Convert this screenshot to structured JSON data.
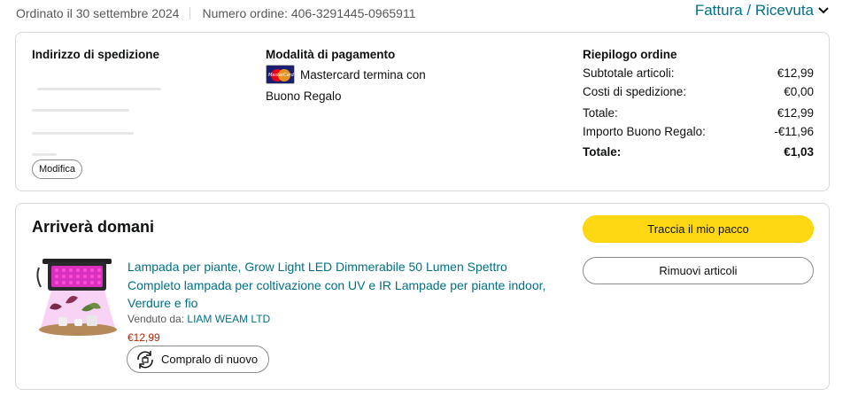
{
  "header": {
    "order_date": "Ordinato il 30 settembre 2024",
    "order_number": "Numero ordine: 406-3291445-0965911",
    "invoice_link": "Fattura / Ricevuta"
  },
  "shipping": {
    "title": "Indirizzo di spedizione",
    "edit_button": "Modifica"
  },
  "payment": {
    "title": "Modalità di pagamento",
    "card_text": "Mastercard termina con",
    "card_logo_text": "MasterCard",
    "gift_card": "Buono Regalo"
  },
  "summary": {
    "title": "Riepilogo ordine",
    "rows": [
      {
        "label": "Subtotale articoli:",
        "value": "€12,99"
      },
      {
        "label": "Costi di spedizione:",
        "value": "€0,00"
      },
      {
        "label": "Totale:",
        "value": "€12,99"
      },
      {
        "label": "Importo Buono Regalo:",
        "value": "-€11,96"
      }
    ],
    "grand_total_label": "Totale:",
    "grand_total_value": "€1,03"
  },
  "delivery": {
    "title": "Arriverà domani",
    "track_button": "Traccia il mio pacco",
    "remove_button": "Rimuovi articoli",
    "item": {
      "title": "Lampada per piante, Grow Light LED Dimmerabile 50 Lumen Spettro Completo lampada per coltivazione con UV e IR Lampade per piante indoor, Verdure e fio",
      "seller_label": "Venduto da:",
      "seller_name": "LIAM WEAM LTD",
      "price": "€12,99",
      "rebuy_button": "Compralo di nuovo"
    }
  },
  "colors": {
    "link": "#007185",
    "price": "#b12704",
    "primary_button": "#ffd814",
    "border": "#d5d9d9"
  }
}
